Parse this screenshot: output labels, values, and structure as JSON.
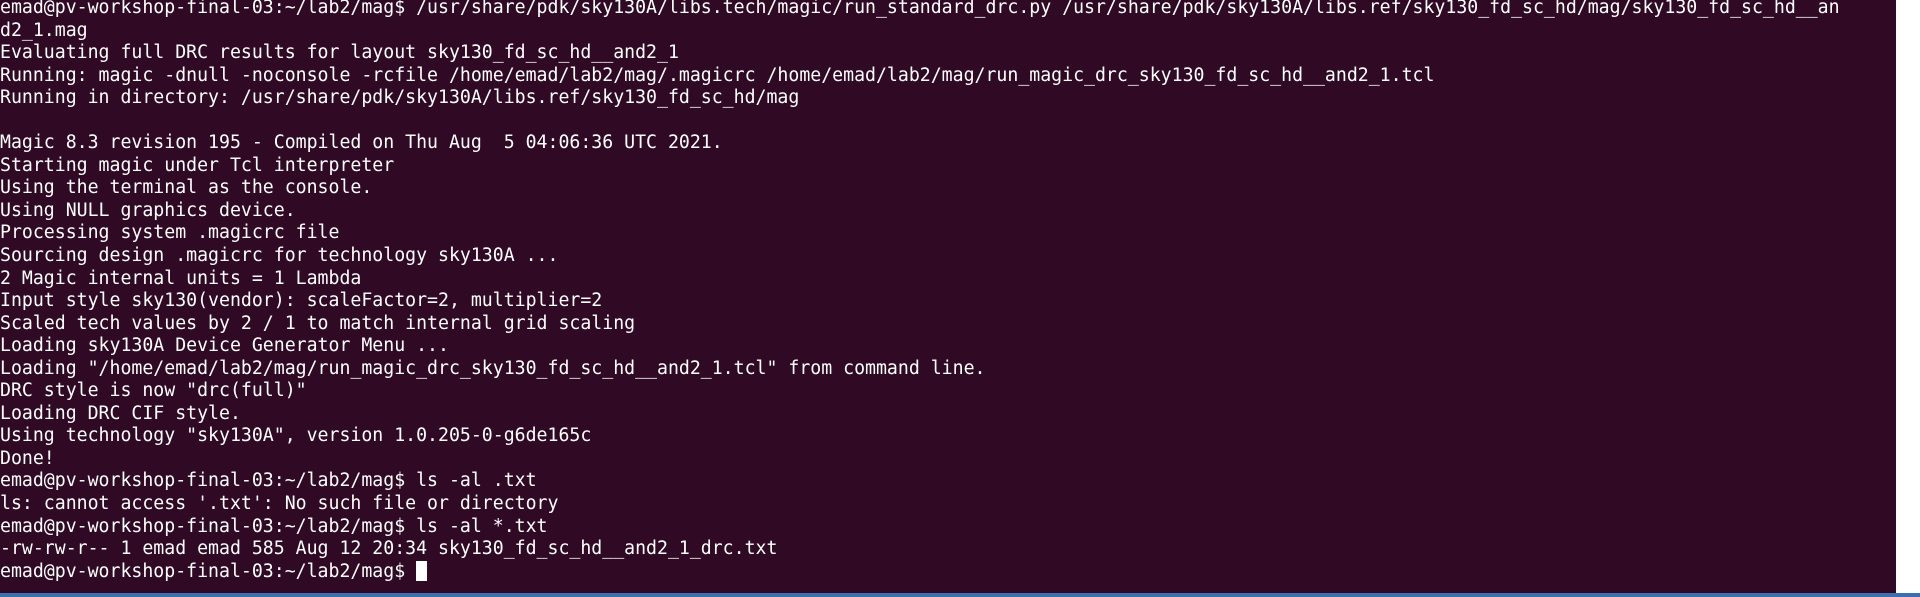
{
  "terminal": {
    "lines": [
      "emad@pv-workshop-final-03:~/lab2/mag$ /usr/share/pdk/sky130A/libs.tech/magic/run_standard_drc.py /usr/share/pdk/sky130A/libs.ref/sky130_fd_sc_hd/mag/sky130_fd_sc_hd__an",
      "d2_1.mag",
      "Evaluating full DRC results for layout sky130_fd_sc_hd__and2_1",
      "Running: magic -dnull -noconsole -rcfile /home/emad/lab2/mag/.magicrc /home/emad/lab2/mag/run_magic_drc_sky130_fd_sc_hd__and2_1.tcl",
      "Running in directory: /usr/share/pdk/sky130A/libs.ref/sky130_fd_sc_hd/mag",
      "",
      "Magic 8.3 revision 195 - Compiled on Thu Aug  5 04:06:36 UTC 2021.",
      "Starting magic under Tcl interpreter",
      "Using the terminal as the console.",
      "Using NULL graphics device.",
      "Processing system .magicrc file",
      "Sourcing design .magicrc for technology sky130A ...",
      "2 Magic internal units = 1 Lambda",
      "Input style sky130(vendor): scaleFactor=2, multiplier=2",
      "Scaled tech values by 2 / 1 to match internal grid scaling",
      "Loading sky130A Device Generator Menu ...",
      "Loading \"/home/emad/lab2/mag/run_magic_drc_sky130_fd_sc_hd__and2_1.tcl\" from command line.",
      "DRC style is now \"drc(full)\"",
      "Loading DRC CIF style.",
      "Using technology \"sky130A\", version 1.0.205-0-g6de165c",
      "Done!",
      "emad@pv-workshop-final-03:~/lab2/mag$ ls -al .txt",
      "ls: cannot access '.txt': No such file or directory",
      "emad@pv-workshop-final-03:~/lab2/mag$ ls -al *.txt",
      "-rw-rw-r-- 1 emad emad 585 Aug 12 20:34 sky130_fd_sc_hd__and2_1_drc.txt"
    ],
    "prompt": "emad@pv-workshop-final-03:~/lab2/mag$ ",
    "colors": {
      "background": "#300a24",
      "foreground": "#ffffff"
    }
  }
}
